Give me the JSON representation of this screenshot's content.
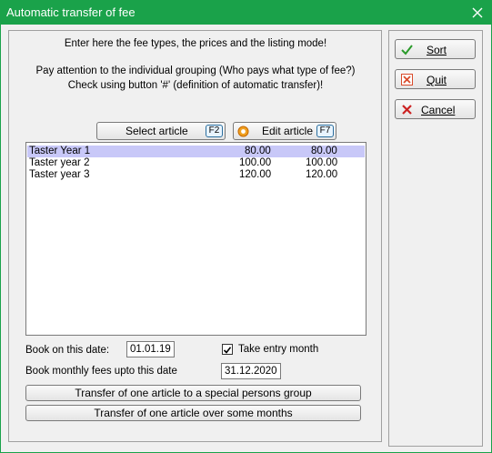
{
  "window": {
    "title": "Automatic transfer of fee"
  },
  "instructions": {
    "line1": "Enter here the fee types, the prices and the listing mode!",
    "line2": "Pay attention to the individual grouping (Who pays what type of fee?)",
    "line3": "Check using button '#' (definition of automatic transfer)!"
  },
  "buttons": {
    "select_article": "Select article",
    "select_article_key": "F2",
    "edit_article": "Edit article",
    "edit_article_key": "F7",
    "transfer_special": "Transfer of one article to a special persons group",
    "transfer_months": "Transfer of one article over some months"
  },
  "articles": [
    {
      "name": "Taster Year 1",
      "price": "80.00",
      "amount": "80.00"
    },
    {
      "name": "Taster year 2",
      "price": "100.00",
      "amount": "100.00"
    },
    {
      "name": "Taster year 3",
      "price": "120.00",
      "amount": "120.00"
    }
  ],
  "form": {
    "book_date_label": "Book on this date:",
    "book_date_value": "01.01.19",
    "take_entry_label": "Take entry month",
    "take_entry_checked": true,
    "monthly_label": "Book monthly fees upto this date",
    "monthly_value": "31.12.2020"
  },
  "side_buttons": {
    "sort": "Sort",
    "quit": "Quit",
    "cancel": "Cancel"
  },
  "colors": {
    "titlebar": "#1aa24a",
    "selected_row": "#c8c8f8",
    "sort_check": "#2a9a2a",
    "quit_icon": "#d94b2b",
    "cancel_icon": "#cc2222"
  }
}
